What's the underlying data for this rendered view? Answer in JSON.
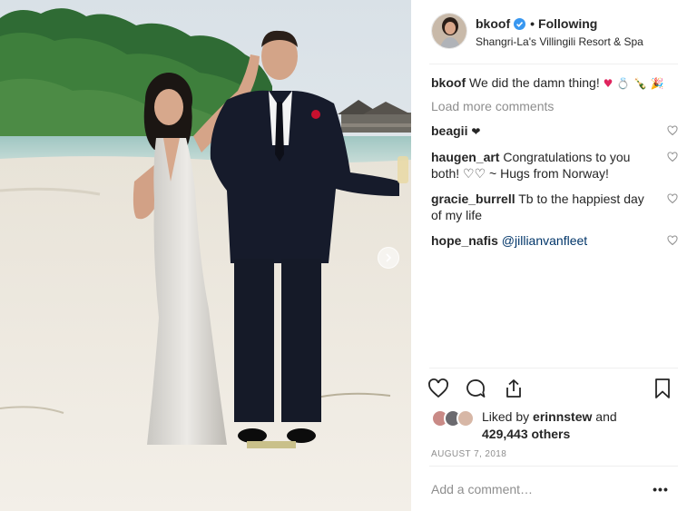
{
  "post": {
    "username": "bkoof",
    "follow_status": "Following",
    "separator": "•",
    "location": "Shangri-La's Villingili Resort & Spa",
    "caption": {
      "username": "bkoof",
      "text": "We did the damn thing!",
      "emojis": "♥ 💍 🍾 🎉"
    },
    "load_more_label": "Load more comments",
    "comments": [
      {
        "username": "beagii",
        "text": "",
        "emoji": "❤"
      },
      {
        "username": "haugen_art",
        "text": "Congratulations to you both! ♡♡ ~ Hugs from Norway!",
        "emoji": ""
      },
      {
        "username": "gracie_burrell",
        "text": "Tb to the happiest day of my life",
        "emoji": ""
      },
      {
        "username": "hope_nafis",
        "text": "@jillianvanfleet",
        "emoji": ""
      }
    ],
    "likes": {
      "prefix": "Liked by",
      "liker": "erinnstew",
      "connector": "and",
      "count_text": "429,443 others"
    },
    "date": "AUGUST 7, 2018",
    "add_comment_placeholder": "Add a comment…",
    "more_label": "•••"
  },
  "icons": {
    "avatar": "profile-photo",
    "verified": "verified-badge-icon",
    "like": "heart-outline-icon",
    "comment": "speech-bubble-icon",
    "share": "share-upload-icon",
    "save": "bookmark-icon",
    "carousel": "chevron-right-icon"
  },
  "colors": {
    "text": "#262626",
    "muted": "#8e8e8e",
    "verified": "#3897f0",
    "divider": "#efefef",
    "mention": "#003569"
  }
}
